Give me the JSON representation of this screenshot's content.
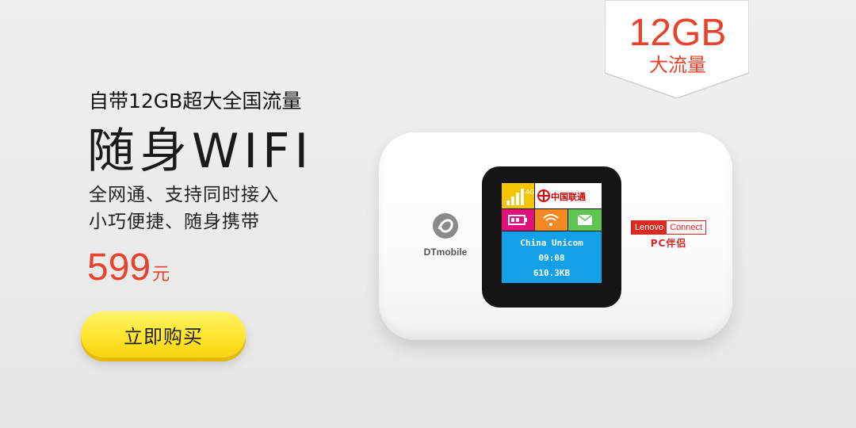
{
  "headline": {
    "subtitle": "自带12GB超大全国流量",
    "title": "随身WIFI",
    "desc_line1": "全网通、支持同时接入",
    "desc_line2": "小巧便捷、随身携带"
  },
  "price": {
    "value": "599",
    "unit": "元"
  },
  "buy_button": {
    "label": "立即购买"
  },
  "corner_tag": {
    "big": "12GB",
    "small": "大流量"
  },
  "device": {
    "left_brand": "DTmobile",
    "right_brand_red": "Lenovo",
    "right_brand_text": "Connect",
    "right_brand_sub": "PC伴侣",
    "screen": {
      "carrier": "中国联通",
      "network_name": "China Unicom",
      "time": "09:08",
      "data_used": "610.3KB"
    }
  },
  "colors": {
    "accent_red": "#e8412c",
    "button_yellow": "#ffe52e",
    "screen_blue": "#12a0e8"
  }
}
